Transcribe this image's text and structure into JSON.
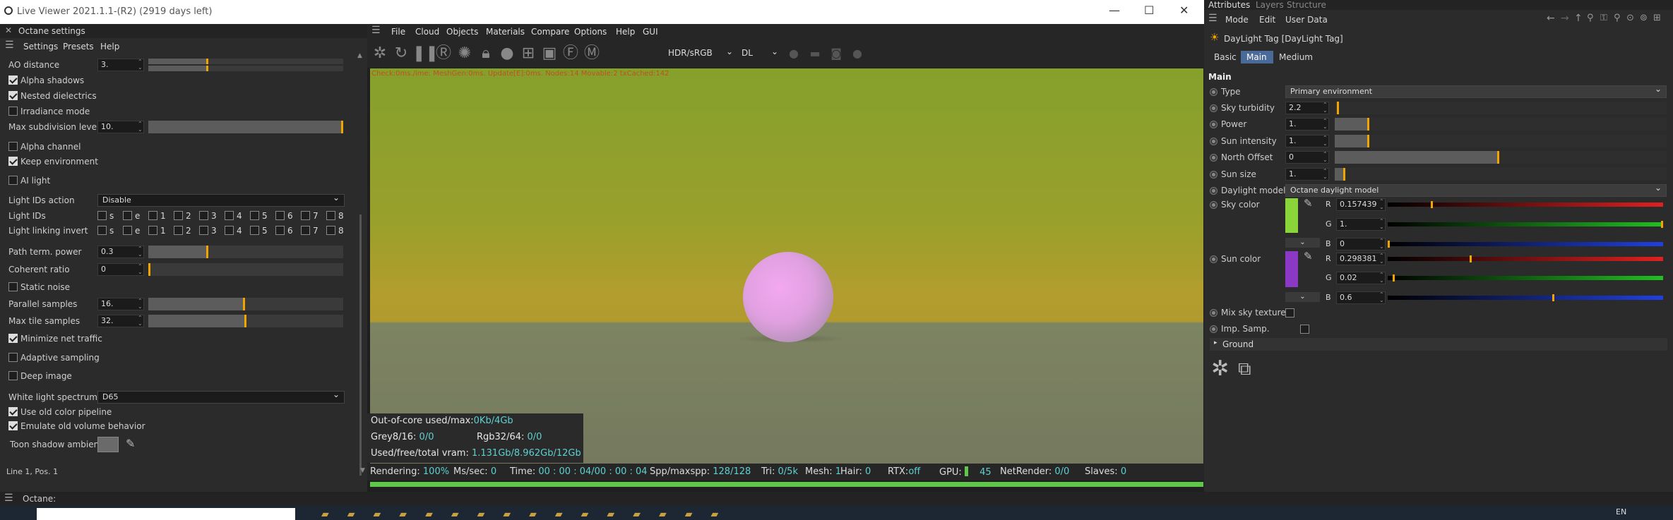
{
  "window": {
    "title": "Live Viewer 2021.1.1-(R2) (2919 days left)",
    "minimize": "—",
    "maximize": "☐",
    "close": "✕"
  },
  "left_panel": {
    "title": "Octane settings",
    "menu": [
      "Settings",
      "Presets",
      "Help"
    ],
    "ao_distance": {
      "label": "AO distance",
      "value": "3."
    },
    "alpha_shadows": {
      "label": "Alpha shadows",
      "checked": true
    },
    "nested_dielectrics": {
      "label": "Nested dielectrics",
      "checked": true
    },
    "irradiance_mode": {
      "label": "Irradiance mode",
      "checked": false
    },
    "max_subdivision": {
      "label": "Max subdivision level",
      "value": "10."
    },
    "alpha_channel": {
      "label": "Alpha channel",
      "checked": false
    },
    "keep_environment": {
      "label": "Keep environment",
      "checked": true
    },
    "ai_light": {
      "label": "AI light",
      "checked": false
    },
    "light_ids_action": {
      "label": "Light IDs action",
      "value": "Disable"
    },
    "light_ids": {
      "label": "Light IDs",
      "options": [
        "s",
        "e",
        "1",
        "2",
        "3",
        "4",
        "5",
        "6",
        "7",
        "8"
      ]
    },
    "light_linking_invert": {
      "label": "Light linking invert",
      "options": [
        "s",
        "e",
        "1",
        "2",
        "3",
        "4",
        "5",
        "6",
        "7",
        "8"
      ]
    },
    "path_term_power": {
      "label": "Path term. power",
      "value": "0.3"
    },
    "coherent_ratio": {
      "label": "Coherent ratio",
      "value": "0"
    },
    "static_noise": {
      "label": "Static noise",
      "checked": false
    },
    "parallel_samples": {
      "label": "Parallel samples",
      "value": "16."
    },
    "max_tile_samples": {
      "label": "Max tile samples",
      "value": "32."
    },
    "minimize_net_traffic": {
      "label": "Minimize net traffic",
      "checked": true
    },
    "adaptive_sampling": {
      "label": "Adaptive sampling",
      "checked": false
    },
    "deep_image": {
      "label": "Deep image",
      "checked": false
    },
    "white_light_spectrum": {
      "label": "White light spectrum",
      "value": "D65"
    },
    "use_old_color_pipeline": {
      "label": "Use old color pipeline",
      "checked": true
    },
    "emulate_old_volume": {
      "label": "Emulate old volume behavior",
      "checked": true
    },
    "toon_shadow_ambient": {
      "label": "Toon shadow ambient"
    },
    "status_line": "Line 1, Pos. 1"
  },
  "viewer": {
    "menu": [
      "File",
      "Cloud",
      "Objects",
      "Materials",
      "Compare",
      "Options",
      "Help",
      "GUI"
    ],
    "color_space": "HDR/sRGB",
    "render_mode": "DL",
    "overlay_text": "Check:0ms./ime: MeshGen:0ms. Update[E]:0ms. Nodes:14 Movable:2 txCached:142",
    "stats": {
      "out_of_core_label": "Out-of-core used/max:",
      "out_of_core_value": "0Kb/4Gb",
      "grey_label": "Grey8/16:",
      "grey_value": "0/0",
      "rgb_label": "Rgb32/64:",
      "rgb_value": "0/0",
      "vram_label": "Used/free/total vram:",
      "vram_value": "1.131Gb/8.962Gb/12Gb"
    },
    "status": {
      "rendering_label": "Rendering:",
      "rendering_value": "100%",
      "mssec_label": "Ms/sec:",
      "mssec_value": "0",
      "time_label": "Time:",
      "time_value": "00 : 00 : 04/00 : 00 : 04",
      "spp_label": "Spp/maxspp:",
      "spp_value": "128/128",
      "tri_label": "Tri:",
      "tri_value": "0/5k",
      "mesh_label": "Mesh:",
      "mesh_value": "1",
      "hair_label": "Hair:",
      "hair_value": "0",
      "rtx_label": "RTX:",
      "rtx_value": "off",
      "gpu_label": "GPU:",
      "gpu_value": "45",
      "netrender_label": "NetRender:",
      "netrender_value": "0/0",
      "slaves_label": "Slaves:",
      "slaves_value": "0"
    },
    "progress": 1.0
  },
  "right_panel": {
    "tabs": [
      "Attributes",
      "Layers",
      "Structure"
    ],
    "menu": [
      "Mode",
      "Edit",
      "User Data"
    ],
    "object_title": "DayLight Tag [DayLight Tag]",
    "subtabs": [
      "Basic",
      "Main",
      "Medium"
    ],
    "section": "Main",
    "type": {
      "label": "Type",
      "value": "Primary environment"
    },
    "sky_turbidity": {
      "label": "Sky turbidity",
      "value": "2.2"
    },
    "power": {
      "label": "Power",
      "value": "1."
    },
    "sun_intensity": {
      "label": "Sun intensity",
      "value": "1."
    },
    "north_offset": {
      "label": "North Offset",
      "value": "0"
    },
    "sun_size": {
      "label": "Sun size",
      "value": "1."
    },
    "daylight_model": {
      "label": "Daylight model",
      "value": "Octane daylight model"
    },
    "sky_color": {
      "label": "Sky color",
      "swatch": "#8ad53a",
      "r": "0.157439",
      "g": "1.",
      "b": "0"
    },
    "sun_color": {
      "label": "Sun color",
      "swatch": "#8b39c4",
      "r": "0.298381",
      "g": "0.02",
      "b": "0.6"
    },
    "channel_labels": {
      "r": "R",
      "g": "G",
      "b": "B"
    },
    "mix_sky_texture": {
      "label": "Mix sky texture",
      "checked": false
    },
    "imp_samp": {
      "label": "Imp. Samp.",
      "checked": false
    },
    "ground": "Ground"
  },
  "bottom": {
    "label": "Octane:",
    "language": "EN"
  }
}
